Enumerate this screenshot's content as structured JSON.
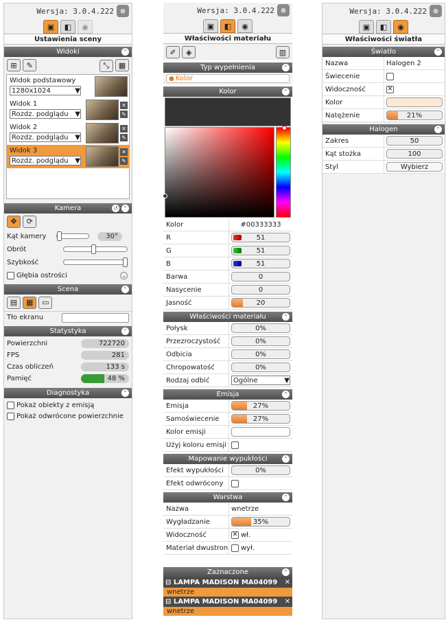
{
  "version_label": "Wersja: 3.0.4.222",
  "scene": {
    "title": "Ustawienia sceny",
    "sections": {
      "widoki": "Widoki",
      "kamera": "Kamera",
      "scena": "Scena",
      "statystyka": "Statystyka",
      "diagnostyka": "Diagnostyka"
    },
    "base_view": {
      "label": "Widok podstawowy",
      "resolution": "1280x1024"
    },
    "views": [
      {
        "name": "Widok 1",
        "mode": "Rozdz. podglądu"
      },
      {
        "name": "Widok 2",
        "mode": "Rozdz. podglądu"
      },
      {
        "name": "Widok 3",
        "mode": "Rozdz. podglądu",
        "selected": true
      }
    ],
    "camera": {
      "angle_label": "Kąt kamery",
      "angle_value": "30°",
      "rotation_label": "Obrót",
      "speed_label": "Szybkość",
      "dof_label": "Głębia ostrości"
    },
    "scene_bg_label": "Tło ekranu",
    "stats": [
      {
        "label": "Powierzchni",
        "value": "722720"
      },
      {
        "label": "FPS",
        "value": "281"
      },
      {
        "label": "Czas obliczeń",
        "value": "133 s"
      },
      {
        "label": "Pamięć",
        "value": "48 %",
        "fill": 0.48
      }
    ],
    "diag": {
      "opt1": "Pokaż obiekty z emisją",
      "opt2": "Pokaż odwrócone powierzchnie"
    }
  },
  "material": {
    "title": "Właściwości materiału",
    "fill_type_header": "Typ wypełnienia",
    "fill_type_value": "Kolor",
    "color_header": "Kolor",
    "color_preview": "#333333",
    "rows": {
      "kolor": {
        "label": "Kolor",
        "value": "#00333333"
      },
      "r": {
        "label": "R",
        "value": "51"
      },
      "g": {
        "label": "G",
        "value": "51"
      },
      "b": {
        "label": "B",
        "value": "51"
      },
      "barwa": {
        "label": "Barwa",
        "value": "0"
      },
      "nasycenie": {
        "label": "Nasycenie",
        "value": "0"
      },
      "jasnosc": {
        "label": "Jasność",
        "value": "20"
      }
    },
    "props_header": "Właściwości materiału",
    "props": [
      {
        "label": "Połysk",
        "value": "0%"
      },
      {
        "label": "Przezroczystość",
        "value": "0%"
      },
      {
        "label": "Odbicia",
        "value": "0%"
      },
      {
        "label": "Chropowatość",
        "value": "0%"
      }
    ],
    "reflection_type": {
      "label": "Rodzaj odbić",
      "value": "Ogólne"
    },
    "emission_header": "Emisja",
    "emisja": {
      "label": "Emisja",
      "value": "27%"
    },
    "samoswiecenie": {
      "label": "Samoświecenie",
      "value": "27%"
    },
    "kolor_emisji": {
      "label": "Kolor emisji"
    },
    "uzyj_koloru": {
      "label": "Użyj koloru emisji"
    },
    "bump_header": "Mapowanie wypukłości",
    "efekt_wyp": {
      "label": "Efekt wypukłości",
      "value": "0%"
    },
    "efekt_odw": {
      "label": "Efekt odwrócony"
    },
    "layer_header": "Warstwa",
    "layer": {
      "nazwa": {
        "label": "Nazwa",
        "value": "wnetrze"
      },
      "wygladzanie": {
        "label": "Wygładzanie",
        "value": "35%"
      },
      "widocznosc": {
        "label": "Widoczność",
        "value": "wł."
      },
      "dwustronny": {
        "label": "Materiał dwustronny",
        "value": "wył."
      }
    },
    "selected_header": "Zaznaczone",
    "selected_items": [
      {
        "name": "LAMPA MADISON MA04099",
        "sub": "wnetrze"
      },
      {
        "name": "LAMPA MADISON MA04099",
        "sub": "wnetrze"
      }
    ]
  },
  "light": {
    "title": "Właściwości światła",
    "light_header": "Światło",
    "nazwa": {
      "label": "Nazwa",
      "value": "Halogen 2"
    },
    "swiecenie": {
      "label": "Świecenie"
    },
    "widocznosc": {
      "label": "Widoczność"
    },
    "kolor": {
      "label": "Kolor"
    },
    "natezenie": {
      "label": "Natężenie",
      "value": "21%"
    },
    "halogen_header": "Halogen",
    "zakres": {
      "label": "Zakres",
      "value": "50"
    },
    "kat": {
      "label": "Kąt stożka",
      "value": "100"
    },
    "styl": {
      "label": "Styl",
      "value": "Wybierz"
    }
  }
}
